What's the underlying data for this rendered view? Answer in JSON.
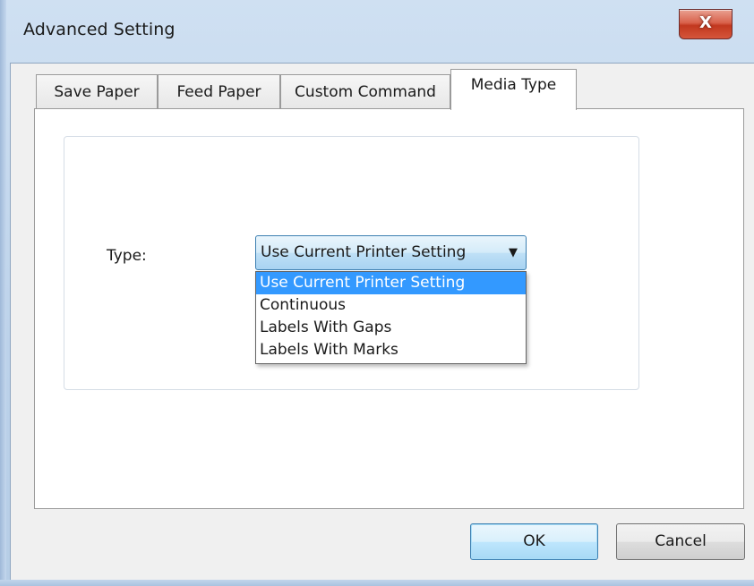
{
  "window": {
    "title": "Advanced Setting",
    "close_glyph": "X"
  },
  "tabs": [
    {
      "label": "Save Paper",
      "active": false
    },
    {
      "label": "Feed Paper",
      "active": false
    },
    {
      "label": "Custom Command",
      "active": false
    },
    {
      "label": "Media Type",
      "active": true
    }
  ],
  "media_type": {
    "type_label": "Type:",
    "selected_value": "Use Current Printer Setting",
    "arrow_icon": "chevron-down-icon",
    "options": [
      "Use Current Printer Setting",
      "Continuous",
      "Labels With Gaps",
      "Labels With Marks"
    ],
    "highlighted_option_index": 0
  },
  "buttons": {
    "ok_label": "OK",
    "cancel_label": "Cancel"
  },
  "colors": {
    "selection": "#3399ff",
    "close_button": "#c2381f",
    "default_button_border": "#3c7fb1"
  }
}
